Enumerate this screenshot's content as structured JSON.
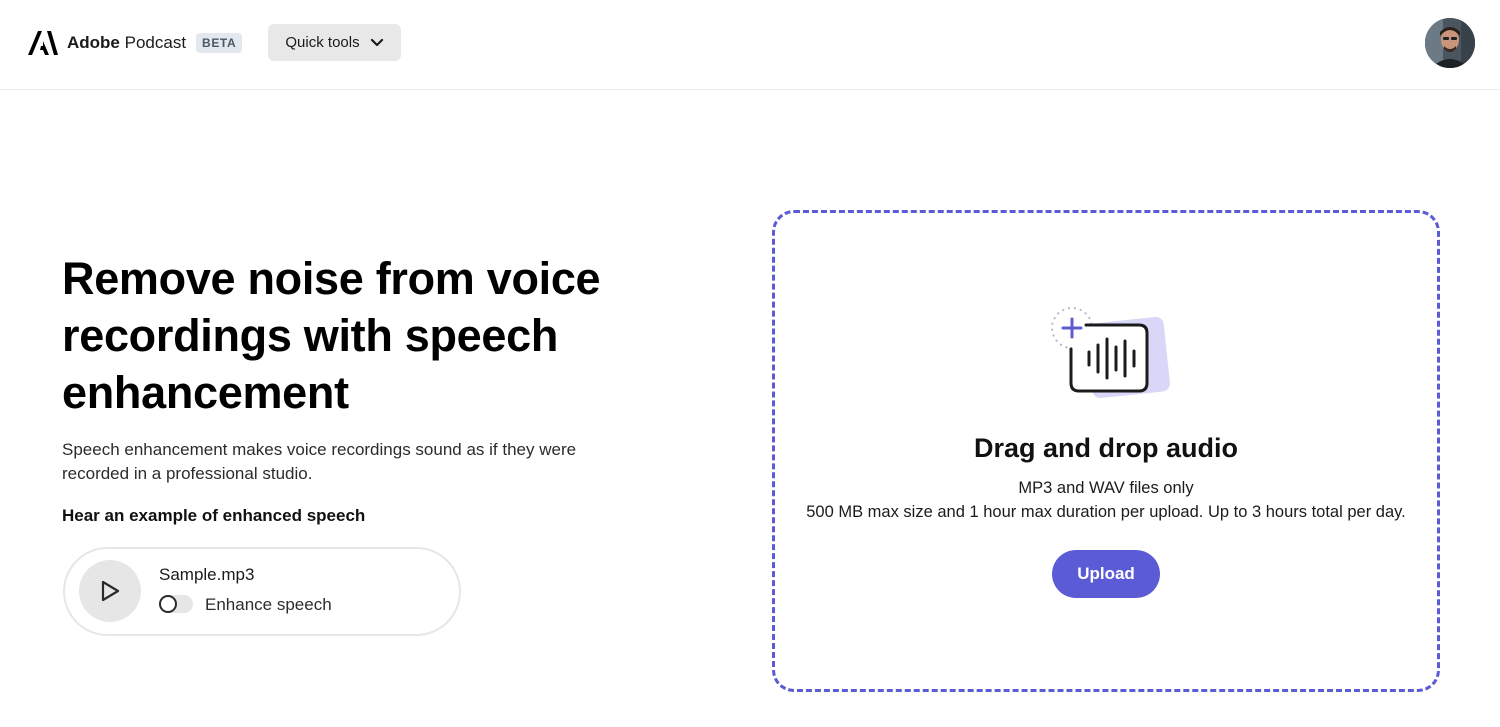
{
  "header": {
    "brand_bold": "Adobe",
    "brand_rest": " Podcast",
    "beta_badge": "BETA",
    "quick_tools_label": "Quick tools"
  },
  "hero": {
    "title": "Remove noise from voice recordings with speech enhancement",
    "description": "Speech enhancement makes voice recordings sound as if they were recorded in a professional studio.",
    "example_label": "Hear an example of enhanced speech"
  },
  "sample_player": {
    "file_name": "Sample.mp3",
    "toggle_label": "Enhance speech",
    "toggle_on": false
  },
  "dropzone": {
    "title": "Drag and drop audio",
    "formats": "MP3 and WAV files only",
    "limits": "500 MB max size and 1 hour max duration per upload. Up to 3 hours total per day.",
    "upload_label": "Upload"
  },
  "icons": [
    "adobe-logo-icon",
    "chevron-down-icon",
    "play-icon",
    "audio-upload-icon"
  ],
  "colors": {
    "accent": "#5b5bd6",
    "accent_light": "#d9d7f7",
    "chip_bg": "#e8e8e8",
    "badge_bg": "#e3e8ee"
  }
}
